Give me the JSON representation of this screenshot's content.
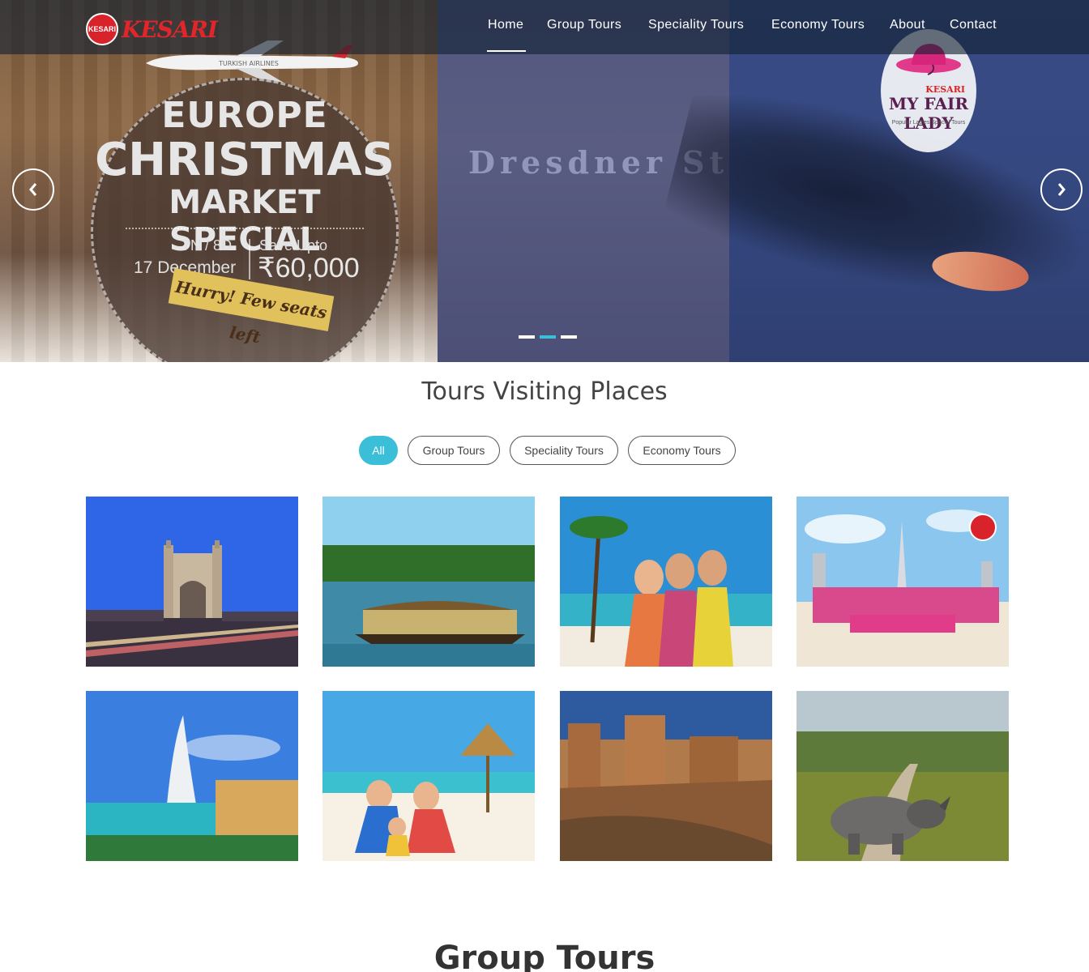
{
  "nav": {
    "brand": "KESARI",
    "brand_badge": "KESARI",
    "items": [
      "Home",
      "Group Tours",
      "Speciality Tours",
      "Economy Tours",
      "About",
      "Contact"
    ],
    "active": "Home"
  },
  "hero": {
    "plane_label": "TURKISH AIRLINES",
    "line1": "EUROPE",
    "line2": "CHRISTMAS",
    "line3": "MARKET SPECIAL",
    "nights": "7N / 8D",
    "date": "17 December",
    "save_label": "Save Upto",
    "amount": "₹60,000",
    "ribbon": "Hurry! Few seats left",
    "background_text": "Dresdner St",
    "fairlady_brand": "KESARI",
    "fairlady_name": "MY FAIR LADY",
    "fairlady_tag": "Popular Ladies Special Tours",
    "slides": 3,
    "active_slide": 2
  },
  "section": {
    "title": "Tours Visiting Places",
    "filters": [
      "All",
      "Group Tours",
      "Speciality Tours",
      "Economy Tours"
    ],
    "active_filter": "All"
  },
  "gallery": [
    {
      "subject": "Charminar at night"
    },
    {
      "subject": "Houseboat on backwaters"
    },
    {
      "subject": "Friends selfie on beach"
    },
    {
      "subject": "Ladies group in Dubai"
    },
    {
      "subject": "Burj Al Arab"
    },
    {
      "subject": "Family on beach"
    },
    {
      "subject": "Gwalior fort"
    },
    {
      "subject": "Rhino in grassland"
    }
  ],
  "next_section": {
    "title": "Group Tours"
  },
  "colors": {
    "accent": "#3bbfd8",
    "brand_red": "#e0262b",
    "nav_bg": "#122032"
  }
}
